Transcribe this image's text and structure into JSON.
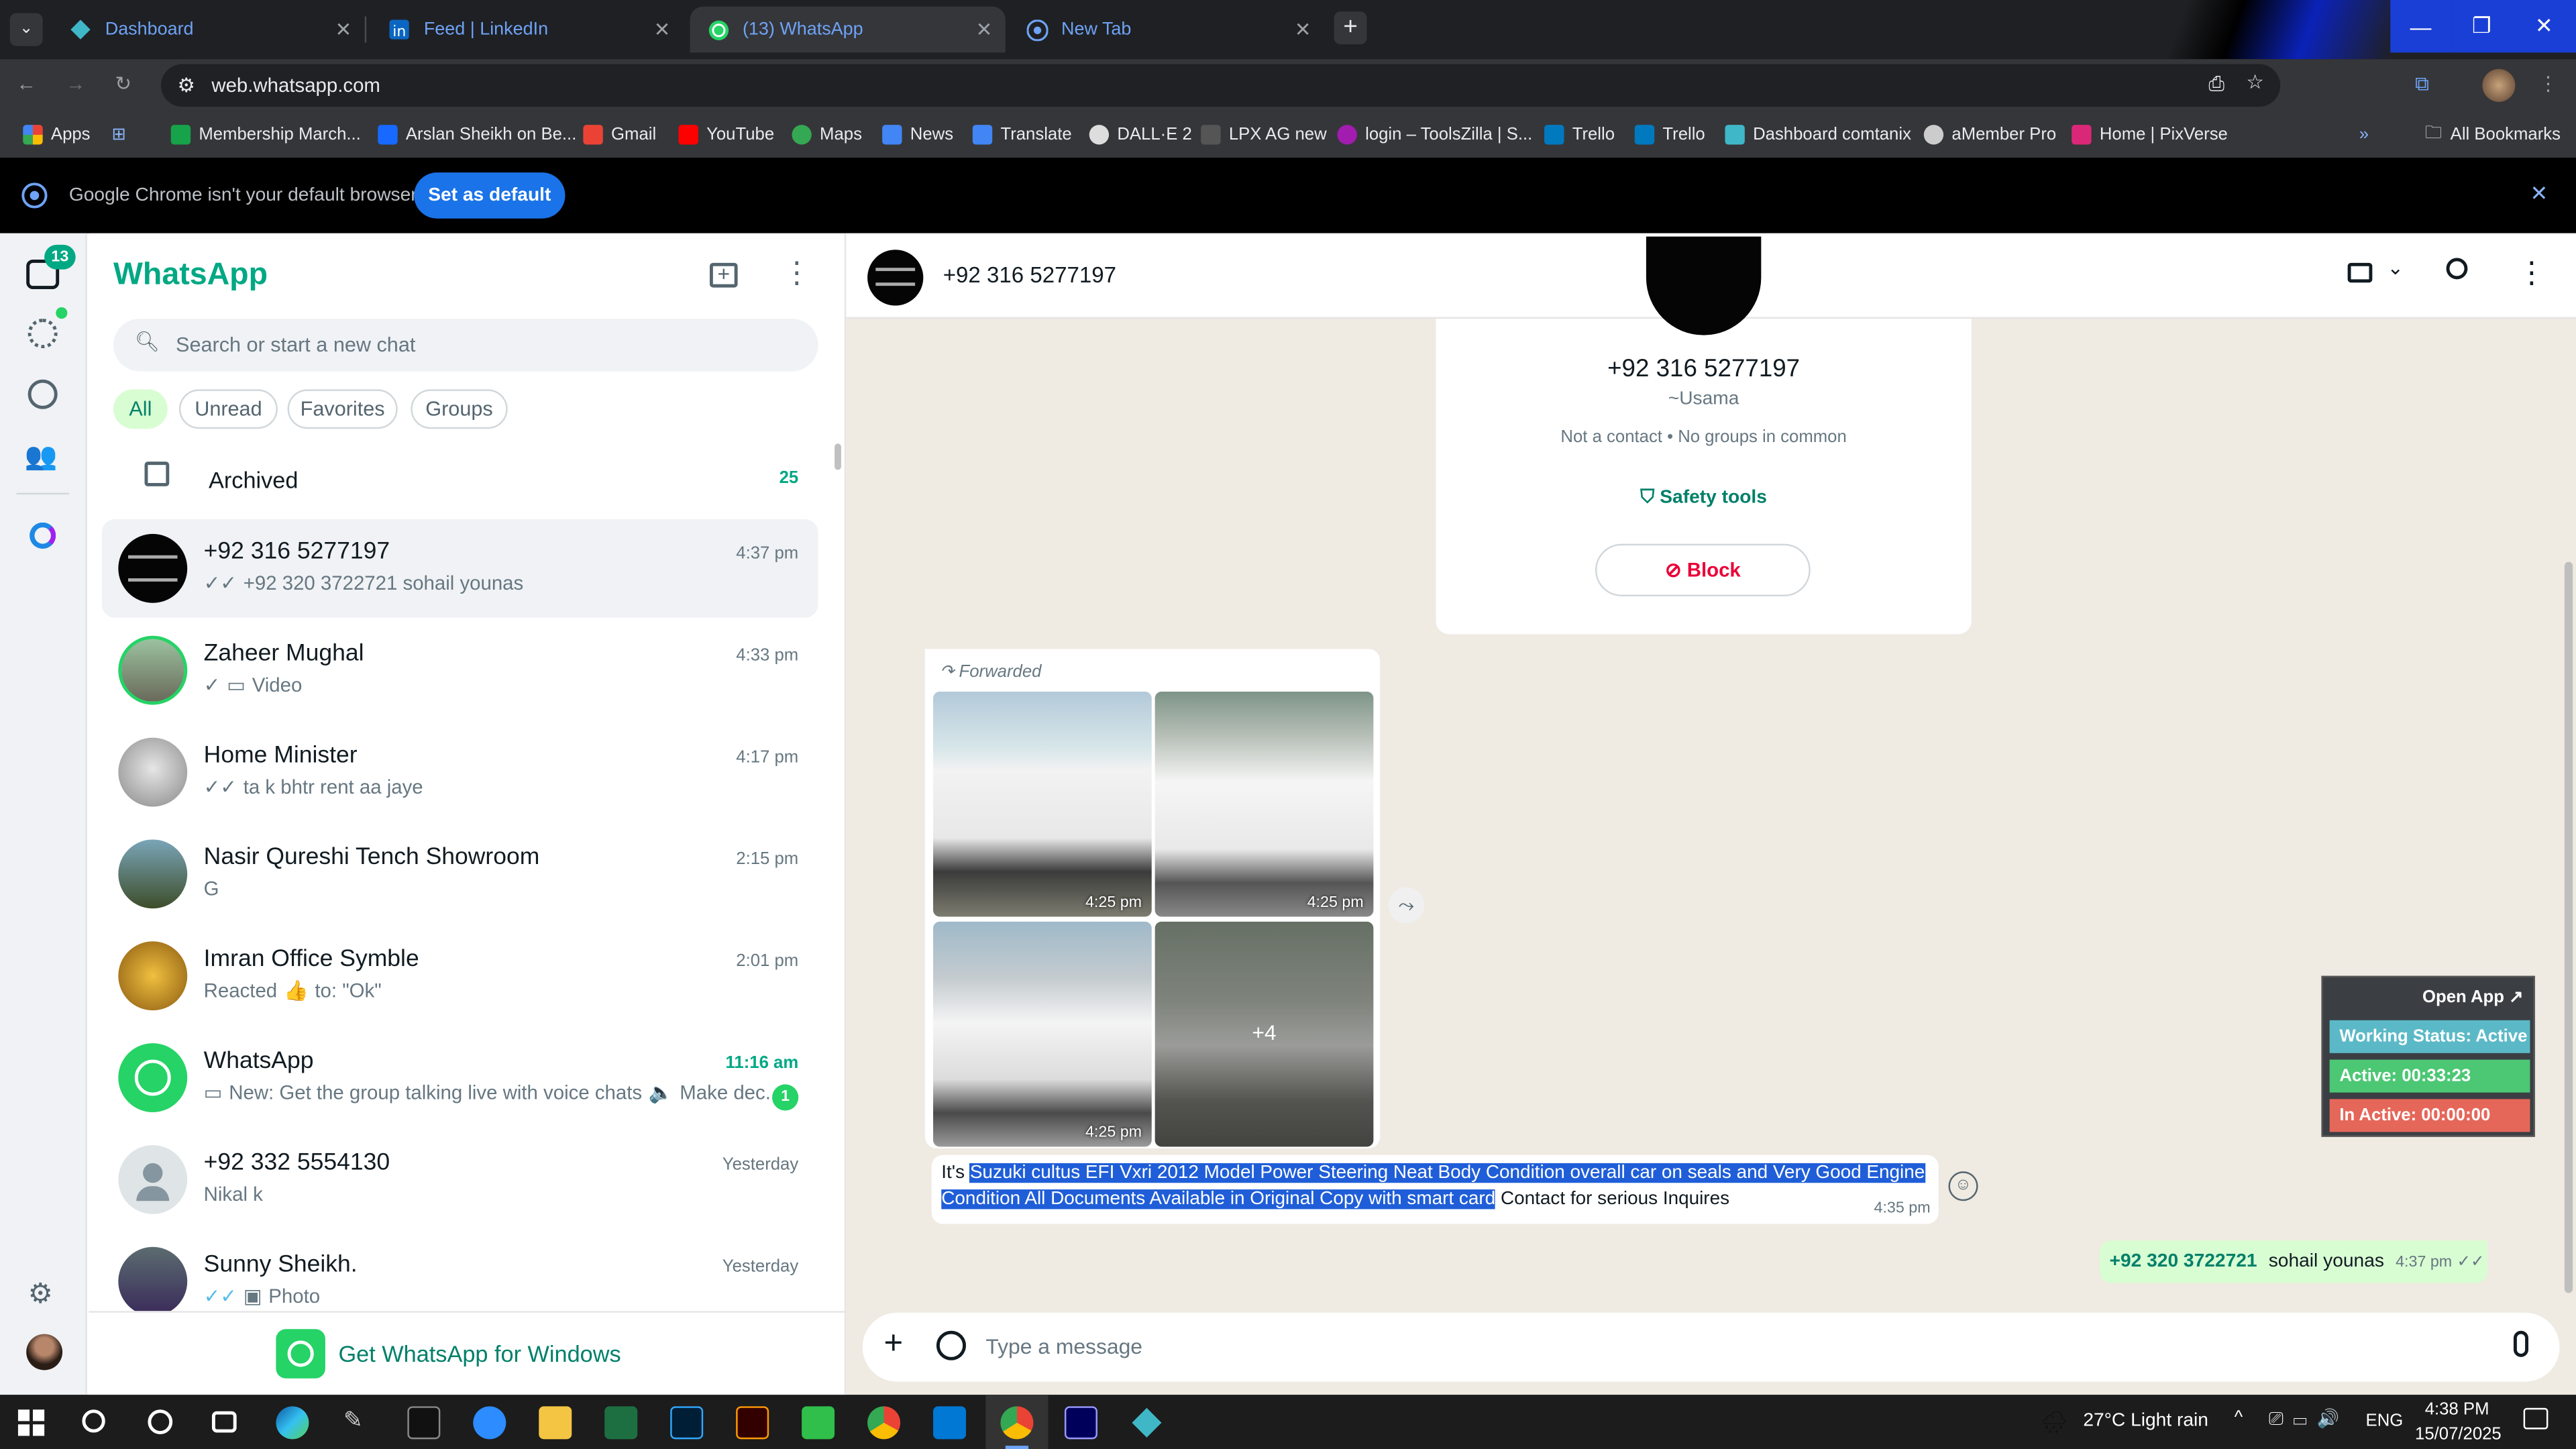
{
  "browser": {
    "tabs": [
      {
        "label": "Dashboard"
      },
      {
        "label": "Feed | LinkedIn"
      },
      {
        "label": "(13) WhatsApp"
      },
      {
        "label": "New Tab"
      }
    ],
    "url": "web.whatsapp.com",
    "bookmarks": [
      "Apps",
      "Membership March...",
      "Arslan Sheikh on Be...",
      "Gmail",
      "YouTube",
      "Maps",
      "News",
      "Translate",
      "DALL·E 2",
      "LPX AG new",
      "login – ToolsZilla | S...",
      "Trello",
      "Trello",
      "Dashboard comtanix",
      "aMember Pro",
      "Home | PixVerse"
    ],
    "all_bookmarks": "All Bookmarks",
    "infobar_text": "Google Chrome isn't your default browser",
    "set_default": "Set as default"
  },
  "rail": {
    "badge": "13"
  },
  "sidebar": {
    "title": "WhatsApp",
    "search_placeholder": "Search or start a new chat",
    "filters": [
      "All",
      "Unread",
      "Favorites",
      "Groups"
    ],
    "archived": "Archived",
    "archived_count": "25",
    "chats": [
      {
        "name": "+92 316 5277197",
        "preview": "+92 320 3722721  sohail younas",
        "time": "4:37 pm"
      },
      {
        "name": "Zaheer Mughal",
        "preview": "Video",
        "time": "4:33 pm"
      },
      {
        "name": "Home Minister",
        "preview": "ta k bhtr rent aa jaye",
        "time": "4:17 pm"
      },
      {
        "name": "Nasir Qureshi Tench Showroom",
        "preview": "G",
        "time": "2:15 pm"
      },
      {
        "name": "Imran Office Symble",
        "preview_a": "Reacted",
        "preview_b": "to: \"Ok\"",
        "time": "2:01 pm"
      },
      {
        "name": "WhatsApp",
        "preview_a": "New: Get the group talking live with voice chats",
        "preview_b": "Make dec...",
        "time": "11:16 am",
        "unread": "1"
      },
      {
        "name": "+92 332 5554130",
        "preview": "Nikal k",
        "time": "Yesterday"
      },
      {
        "name": "Sunny Sheikh.",
        "preview": "Photo",
        "time": "Yesterday"
      }
    ],
    "get_app": "Get WhatsApp for Windows"
  },
  "conversation": {
    "header_name": "+92 316 5277197",
    "contact_card": {
      "phone": "+92 316 5277197",
      "alias": "~Usama",
      "info": "Not a contact • No groups in common",
      "safety": "Safety tools",
      "block": "Block"
    },
    "forwarded": "Forwarded",
    "photo_times": [
      "4:25 pm",
      "4:25 pm",
      "4:25 pm"
    ],
    "more_photos": "+4",
    "msg_pre": "It's ",
    "msg_highlight_1": "Suzuki cultus EFI Vxri 2012 Model Power Steering Neat Body Condition overall car on seals and Very Good Engine",
    "msg_highlight_2": "Condition All Documents Available in Original Copy with smart card",
    "msg_post": " Contact for serious Inquires",
    "msg_time": "4:35 pm",
    "out_contact": "+92 320 3722721",
    "out_name": "sohail younas",
    "out_time": "4:37 pm",
    "input_placeholder": "Type a message"
  },
  "extension": {
    "open": "Open App ↗",
    "status": "Working Status: Active",
    "active": "Active: 00:33:23",
    "inactive": "In Active: 00:00:00"
  },
  "taskbar": {
    "weather": "27°C  Light rain",
    "lang": "ENG",
    "time": "4:38 PM",
    "date": "15/07/2025"
  },
  "colors": {
    "accent": "#00a884",
    "bubble_out": "#d9fdd3",
    "highlight": "#1f5ed8",
    "block": "#ea0038"
  }
}
